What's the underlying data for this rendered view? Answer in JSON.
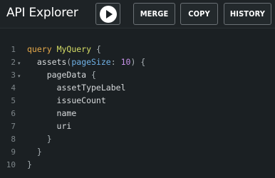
{
  "toolbar": {
    "title": "API Explorer",
    "play_icon": "play-icon",
    "merge_label": "MERGE",
    "copy_label": "COPY",
    "history_label": "HISTORY"
  },
  "editor": {
    "line_numbers": [
      "1",
      "2",
      "3",
      "4",
      "5",
      "6",
      "7",
      "8",
      "9",
      "10"
    ],
    "fold_marker": "▾",
    "tokens": {
      "query_kw": "query",
      "query_name": "MyQuery",
      "l1_brace": " {",
      "field_assets": "assets",
      "l2_paren_open": "(",
      "arg_name": "pageSize",
      "l2_colon": ": ",
      "arg_value": "10",
      "l2_close": ") {",
      "field_pagedata": "pageData",
      "l3_brace": " {",
      "field_assettypelabel": "assetTypeLabel",
      "field_issuecount": "issueCount",
      "field_name": "name",
      "field_uri": "uri",
      "l8_close": "}",
      "l9_close": "}",
      "l10_close": "}"
    }
  }
}
